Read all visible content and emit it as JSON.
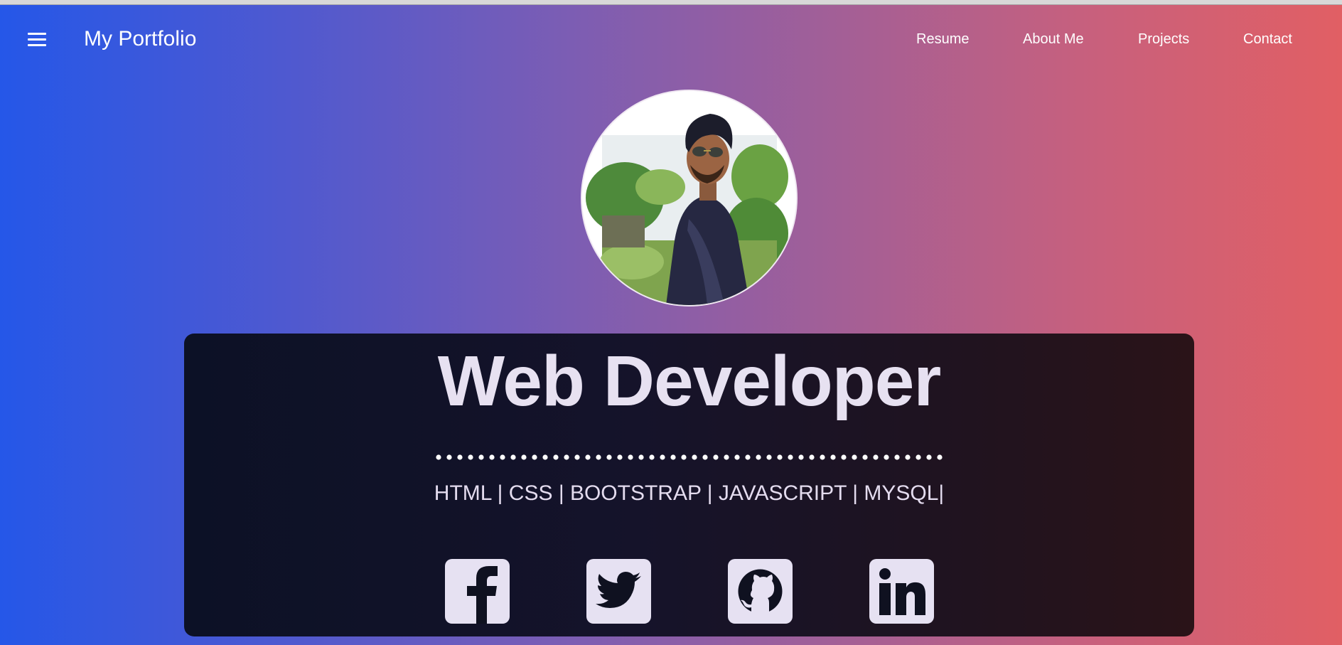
{
  "navbar": {
    "brand": "My Portfolio",
    "links": [
      "Resume",
      "About Me",
      "Projects",
      "Contact"
    ]
  },
  "hero": {
    "title": "Web Developer",
    "skills": "HTML | CSS | BOOTSTRAP | JAVASCRIPT | MYSQL|"
  },
  "social": [
    {
      "icon": "facebook-icon"
    },
    {
      "icon": "twitter-icon"
    },
    {
      "icon": "github-icon"
    },
    {
      "icon": "linkedin-icon"
    }
  ],
  "colors": {
    "gradient_left": "#2557e8",
    "gradient_mid": "#7b5db4",
    "gradient_right": "#e15f64",
    "card_background": "#0c1126",
    "title_text": "#e7e1f1",
    "icon_tile": "#e6e1f2"
  }
}
